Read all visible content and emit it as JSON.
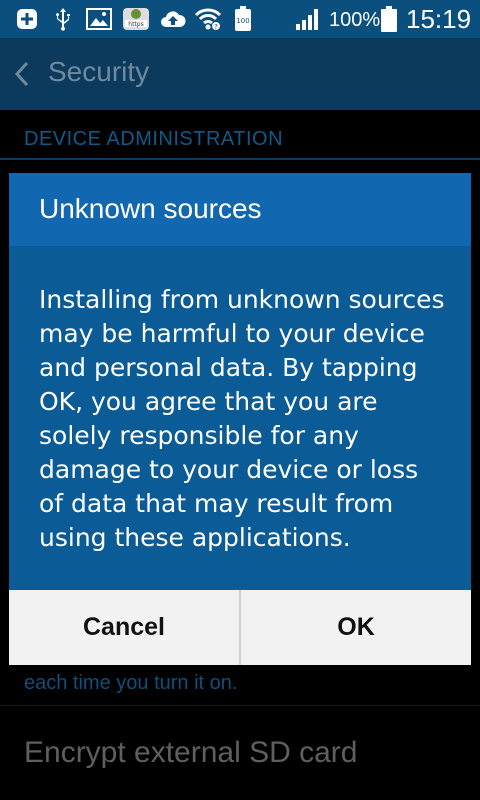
{
  "status_bar": {
    "icons": [
      "add-icon",
      "usb-icon",
      "gallery-icon",
      "https-app-icon",
      "cloud-upload-icon",
      "wifi-icon",
      "battery-saver-icon",
      "signal-icon",
      "battery-icon"
    ],
    "battery_saver_label": "100",
    "https_label": "https",
    "battery_percent": "100%",
    "time": "15:19"
  },
  "action_bar": {
    "title": "Security"
  },
  "background": {
    "section_header": "DEVICE ADMINISTRATION",
    "summary_text": "each time you turn it on.",
    "item_encrypt_sd": "Encrypt external SD card"
  },
  "dialog": {
    "title": "Unknown sources",
    "message": "Installing from unknown sources may be harmful to your device and personal data. By tapping OK, you agree that you are solely responsible for any damage to your device or loss of data that may result from using these applications.",
    "cancel_label": "Cancel",
    "ok_label": "OK"
  },
  "colors": {
    "status_bar_bg": "#0a4f7d",
    "dialog_bg": "#0b5b97",
    "dialog_title_bg": "#1168b1",
    "buttons_bg": "#f2f2f2"
  }
}
